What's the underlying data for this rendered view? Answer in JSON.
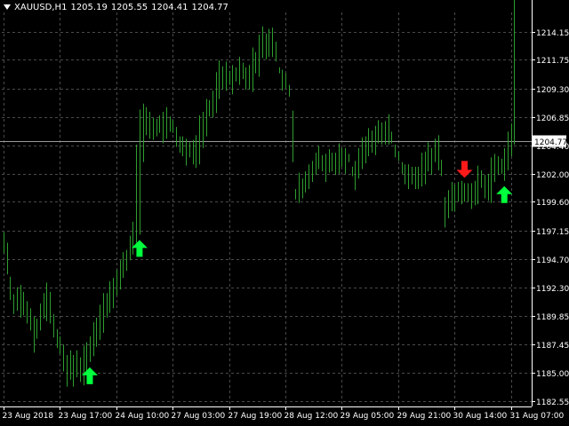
{
  "header": {
    "symbol_timeframe": "XAUUSD,H1",
    "open": "1205.19",
    "high": "1205.55",
    "low": "1204.41",
    "close": "1204.77"
  },
  "colors": {
    "background": "#000000",
    "grid": "#4a4a4a",
    "bars": "#2e9e2e",
    "buy_arrow": "#00ff3c",
    "sell_arrow": "#ff1a1a",
    "current_price_line": "#9a9a9a",
    "axis_text": "#ffffff"
  },
  "chart_data": {
    "type": "ohlc",
    "title": "",
    "y_tick_labels": [
      "1214.15",
      "1211.75",
      "1209.30",
      "1206.85",
      "1204.40",
      "1202.00",
      "1199.60",
      "1197.15",
      "1194.70",
      "1192.30",
      "1189.85",
      "1187.45",
      "1185.00",
      "1182.55"
    ],
    "y_tick_values": [
      1214.15,
      1211.75,
      1209.3,
      1206.85,
      1204.4,
      1202.0,
      1199.6,
      1197.15,
      1194.7,
      1192.3,
      1189.85,
      1187.45,
      1185.0,
      1182.55
    ],
    "ylim": [
      1182.1,
      1215.8
    ],
    "x_tick_labels": [
      "23 Aug 2018",
      "23 Aug 17:00",
      "24 Aug 10:00",
      "27 Aug 03:00",
      "27 Aug 19:00",
      "28 Aug 12:00",
      "29 Aug 05:00",
      "29 Aug 21:00",
      "30 Aug 14:00",
      "31 Aug 07:00"
    ],
    "x_tick_bar_index": [
      0,
      17,
      34,
      51,
      68,
      85,
      102,
      119,
      136,
      153
    ],
    "current_price": 1204.77,
    "current_price_label": "1204.77",
    "bar_count": 155,
    "low": [
      1195.2,
      1193.4,
      1191.2,
      1190.0,
      1190.3,
      1189.7,
      1189.9,
      1189.2,
      1188.6,
      1186.7,
      1187.9,
      1188.6,
      1189.6,
      1189.4,
      1189.2,
      1188.0,
      1187.1,
      1186.6,
      1185.1,
      1183.8,
      1184.4,
      1183.8,
      1184.6,
      1184.2,
      1183.9,
      1185.1,
      1185.9,
      1186.4,
      1187.2,
      1187.8,
      1188.4,
      1189.7,
      1190.1,
      1190.5,
      1191.6,
      1192.1,
      1193.1,
      1193.7,
      1194.6,
      1195.1,
      1196.1,
      1196.8,
      1203.0,
      1205.3,
      1205.0,
      1204.9,
      1205.2,
      1205.5,
      1204.6,
      1205.0,
      1205.6,
      1205.5,
      1204.3,
      1203.8,
      1203.5,
      1202.7,
      1203.4,
      1202.8,
      1202.5,
      1202.8,
      1204.2,
      1205.2,
      1206.9,
      1206.8,
      1207.2,
      1208.4,
      1209.2,
      1209.1,
      1209.6,
      1208.8,
      1209.9,
      1209.6,
      1210.1,
      1209.2,
      1209.2,
      1209.0,
      1210.6,
      1210.3,
      1211.9,
      1211.8,
      1212.0,
      1212.0,
      1211.6,
      1210.6,
      1209.1,
      1209.3,
      1208.6,
      1207.4,
      1199.8,
      1199.5,
      1199.9,
      1200.4,
      1200.7,
      1201.3,
      1201.9,
      1202.4,
      1202.2,
      1201.3,
      1202.1,
      1202.2,
      1201.9,
      1202.0,
      1202.6,
      1202.0,
      1203.0,
      1201.8,
      1200.6,
      1201.6,
      1202.4,
      1202.9,
      1203.5,
      1203.8,
      1203.6,
      1204.6,
      1204.5,
      1204.5,
      1204.5,
      1204.6,
      1203.4,
      1203.1,
      1202.0,
      1201.1,
      1200.7,
      1201.1,
      1200.7,
      1200.7,
      1200.9,
      1201.1,
      1202.2,
      1201.9,
      1203.0,
      1202.3,
      1203.2,
      1197.4,
      1198.2,
      1198.8,
      1198.8,
      1199.6,
      1199.4,
      1199.6,
      1199.6,
      1199.0,
      1199.3,
      1199.4,
      1200.8,
      1199.9,
      1199.7,
      1199.5,
      1201.3,
      1201.9,
      1202.0,
      1201.4,
      1202.3,
      1203.5,
      1204.5
    ],
    "high": [
      1197.0,
      1196.1,
      1193.2,
      1191.7,
      1192.3,
      1192.5,
      1191.9,
      1191.1,
      1190.5,
      1189.8,
      1189.6,
      1190.9,
      1191.8,
      1192.7,
      1191.9,
      1190.0,
      1188.7,
      1188.1,
      1187.4,
      1186.5,
      1186.9,
      1186.5,
      1186.9,
      1186.3,
      1187.3,
      1187.6,
      1188.1,
      1189.3,
      1189.7,
      1190.8,
      1191.8,
      1191.8,
      1192.8,
      1193.1,
      1193.8,
      1194.6,
      1195.3,
      1195.5,
      1196.7,
      1197.9,
      1204.5,
      1207.5,
      1208.0,
      1207.7,
      1207.3,
      1206.8,
      1206.7,
      1207.0,
      1207.3,
      1207.7,
      1206.9,
      1206.6,
      1206.0,
      1205.2,
      1205.2,
      1205.0,
      1204.7,
      1204.9,
      1205.3,
      1207.0,
      1207.3,
      1208.4,
      1208.3,
      1209.1,
      1210.7,
      1211.7,
      1211.2,
      1211.6,
      1210.8,
      1211.3,
      1211.1,
      1212.0,
      1211.5,
      1211.1,
      1211.3,
      1212.8,
      1212.4,
      1213.9,
      1214.6,
      1214.0,
      1214.4,
      1214.5,
      1213.3,
      1211.1,
      1210.9,
      1210.6,
      1209.6,
      1203.0,
      1200.7,
      1202.1,
      1201.6,
      1202.2,
      1202.8,
      1203.1,
      1203.8,
      1204.4,
      1203.6,
      1203.7,
      1204.1,
      1203.8,
      1203.8,
      1204.6,
      1204.2,
      1204.2,
      1203.7,
      1202.6,
      1203.1,
      1204.2,
      1205.1,
      1205.2,
      1205.9,
      1205.7,
      1206.1,
      1206.6,
      1206.4,
      1206.5,
      1207.1,
      1205.6,
      1204.5,
      1203.9,
      1203.0,
      1202.8,
      1202.8,
      1202.6,
      1202.6,
      1202.6,
      1203.8,
      1203.9,
      1204.7,
      1204.2,
      1205.0,
      1205.3,
      1201.8,
      1200.0,
      1200.6,
      1201.3,
      1201.1,
      1201.3,
      1201.4,
      1201.2,
      1201.2,
      1201.2,
      1201.4,
      1202.7,
      1202.3,
      1201.9,
      1202.0,
      1203.4,
      1203.7,
      1203.5,
      1203.3,
      1204.2,
      1205.6,
      1206.3
    ]
  }
}
